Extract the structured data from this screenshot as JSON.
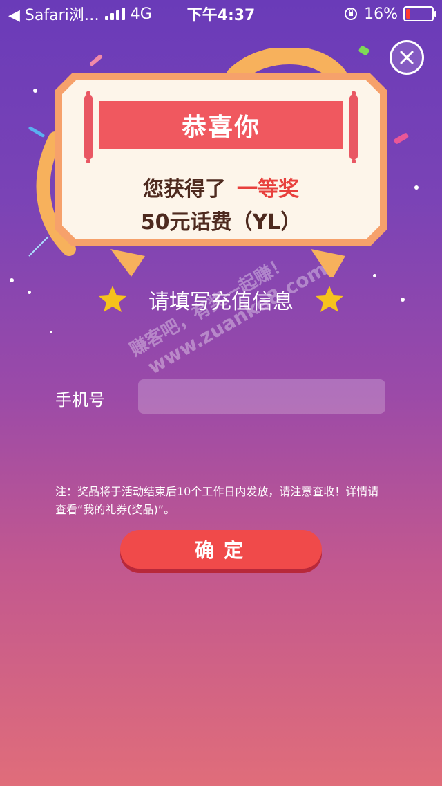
{
  "status_bar": {
    "back_label": "◀ Safari浏…",
    "network": "4G",
    "time": "下午4:37",
    "battery": "16%",
    "battery_level": 0.16
  },
  "card": {
    "title": "恭喜你",
    "prize_prefix": "您获得了",
    "prize_tier": "一等奖",
    "prize_detail": "50元话费（YL）"
  },
  "form": {
    "heading": "请填写充值信息",
    "phone_label": "手机号",
    "phone_value": "",
    "note": "注：奖品将于活动结束后10个工作日内发放，请注意查收！详情请查看“我的礼券(奖品)”。",
    "confirm_label": "确定"
  },
  "watermark": {
    "line1": "赚客吧，有奖一起赚！",
    "line2": "www.zuanke8.com"
  },
  "colors": {
    "accent_red": "#f04a4a",
    "banner_red": "#f0585f",
    "card_border": "#f6a16b",
    "card_fill": "#fdf5ea",
    "star": "#f6c21c"
  },
  "icons": {
    "close": "close-icon",
    "star": "star-icon",
    "back": "back-arrow-icon",
    "signal": "signal-icon",
    "orientation_lock": "orientation-lock-icon",
    "battery": "battery-icon"
  }
}
